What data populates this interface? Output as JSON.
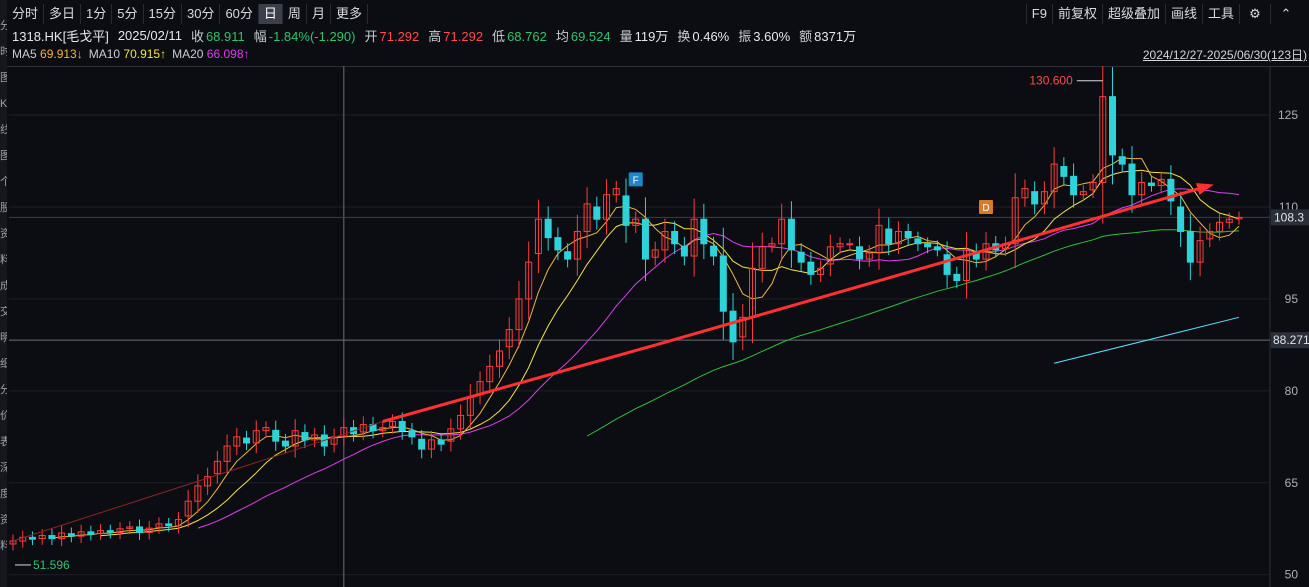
{
  "toolbar": {
    "periods": [
      "分时",
      "多日",
      "1分",
      "5分",
      "15分",
      "30分",
      "60分",
      "日",
      "周",
      "月",
      "更多"
    ],
    "active_period": "日",
    "right": [
      "F9",
      "前复权",
      "超级叠加",
      "画线",
      "工具"
    ]
  },
  "left_strip": [
    "分",
    "时",
    "图",
    "K",
    "线",
    "图",
    "个",
    "股",
    "资",
    "料",
    "成",
    "交",
    "明",
    "细",
    "分",
    "价",
    "表",
    "深",
    "度",
    "资",
    "料"
  ],
  "quote": {
    "code": "1318.HK[毛戈平]",
    "date": "2025/02/11",
    "close_label": "收",
    "close": "68.911",
    "change_label": "幅",
    "change": "-1.84%(-1.290)",
    "open_label": "开",
    "open": "71.292",
    "high_label": "高",
    "high": "71.292",
    "low_label": "低",
    "low": "68.762",
    "avg_label": "均",
    "avg": "69.524",
    "vol_label": "量",
    "vol": "119万",
    "turnover_label": "换",
    "turnover": "0.46%",
    "amplitude_label": "振",
    "amplitude": "3.60%",
    "amount_label": "额",
    "amount": "8371万"
  },
  "ma_legend": [
    {
      "name": "MA5",
      "value": "69.913↓",
      "color": "#f0b43c"
    },
    {
      "name": "MA10",
      "value": "70.915↑",
      "color": "#f4e342"
    },
    {
      "name": "MA20",
      "value": "66.098↑",
      "color": "#e03cf0"
    }
  ],
  "date_range": "2024/12/27-2025/06/30(123日)",
  "colors": {
    "up": "#ff3b3b",
    "down": "#2dd3d9",
    "ma5": "#f0b43c",
    "ma10": "#f4e342",
    "ma20": "#e03cf0",
    "ma60": "#2fbf3a",
    "trendline": "#ff3030",
    "cyanline": "#5fe0ff"
  },
  "chart_data": {
    "type": "candlestick",
    "ylim": [
      48,
      133
    ],
    "yticks": [
      "125",
      "110",
      "95",
      "80",
      "65",
      "50"
    ],
    "high_marker": "130.600",
    "low_marker": "51.596",
    "price_tag_right": "108.3",
    "crosshair_price": "88.271",
    "markers": [
      "F",
      "D"
    ],
    "close_series": [
      55.5,
      56.1,
      55.8,
      56.4,
      55.9,
      56.8,
      56.3,
      57.0,
      56.6,
      57.2,
      56.9,
      57.5,
      57.8,
      56.9,
      57.6,
      58.3,
      58.0,
      59.0,
      62.0,
      64.5,
      66.0,
      68.5,
      71.0,
      72.5,
      71.5,
      73.5,
      74.0,
      71.8,
      71.0,
      73.5,
      72.0,
      72.8,
      71.0,
      72.5,
      74.0,
      73.0,
      74.5,
      73.5,
      74.0,
      75.0,
      73.5,
      72.5,
      70.5,
      72.0,
      71.3,
      73.8,
      76.0,
      79.0,
      81.5,
      84.0,
      86.5,
      90.0,
      95.0,
      101.0,
      108.0,
      105.0,
      103.0,
      101.5,
      106.0,
      110.5,
      108.0,
      112.0,
      113.0,
      107.0,
      108.0,
      101.5,
      103.0,
      106.0,
      104.0,
      102.0,
      108.0,
      104.0,
      102.0,
      93.0,
      88.0,
      92.0,
      100.0,
      103.5,
      104.0,
      108.0,
      103.0,
      101.0,
      99.0,
      100.0,
      103.5,
      104.0,
      104.0,
      101.5,
      102.5,
      107.0,
      104.0,
      106.0,
      105.0,
      104.0,
      103.5,
      103.0,
      99.0,
      98.0,
      103.0,
      101.5,
      104.0,
      103.0,
      104.0,
      111.5,
      113.0,
      110.5,
      112.5,
      117.0,
      115.0,
      112.0,
      112.5,
      114.0,
      128.0,
      118.5,
      117.0,
      112.0,
      114.0,
      113.5,
      114.5,
      111.0,
      106.0,
      101.0,
      104.5,
      106.0,
      107.5,
      108.0,
      108.3
    ]
  }
}
